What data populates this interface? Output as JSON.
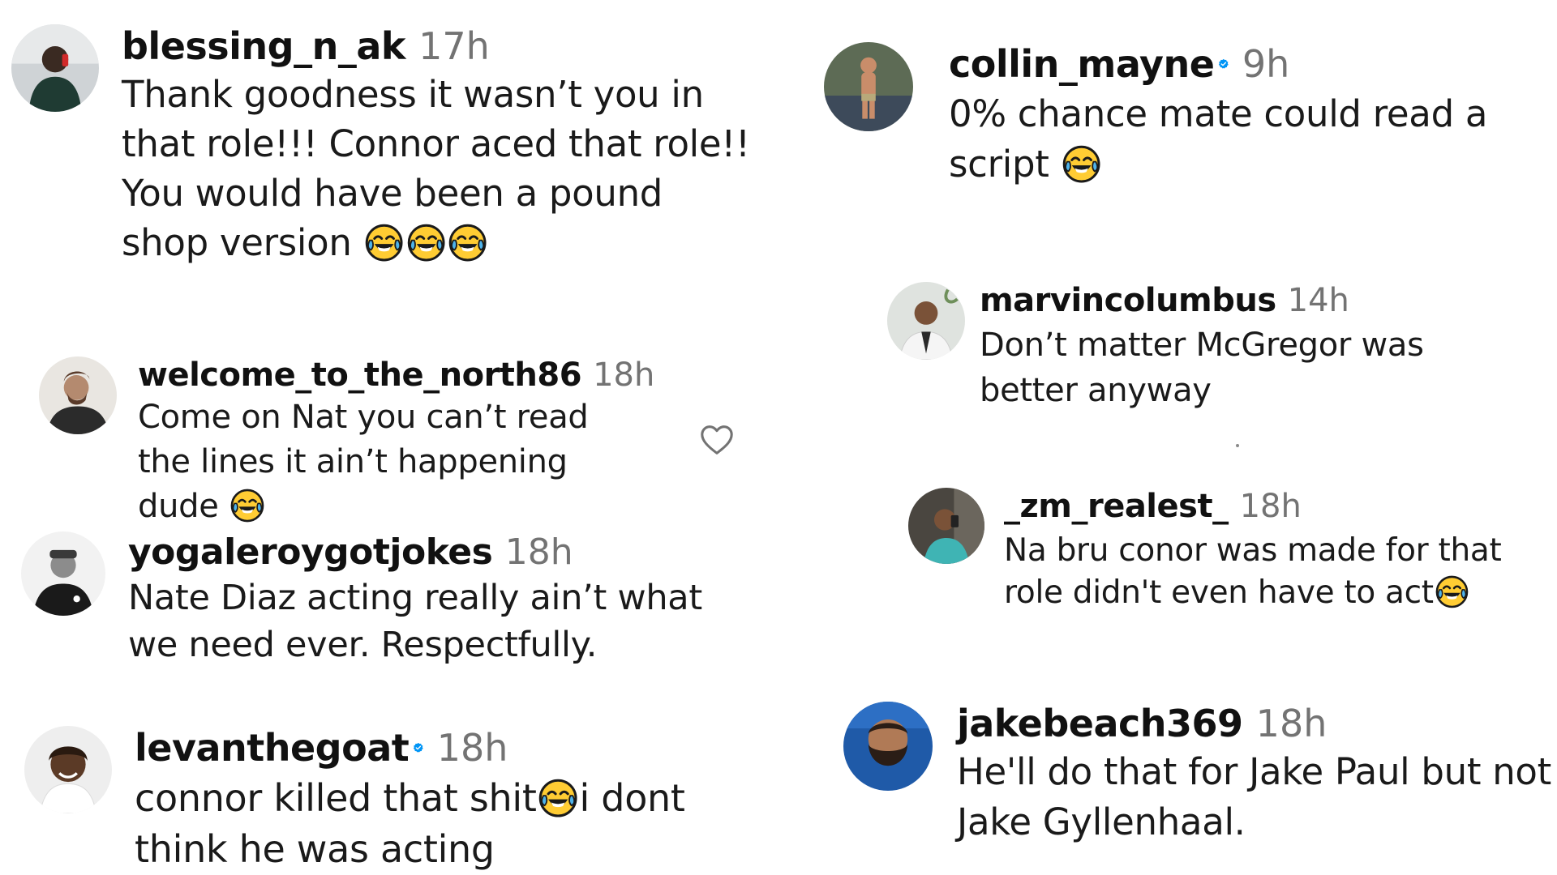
{
  "comments": [
    {
      "id": "blessing",
      "username": "blessing_n_ak",
      "time": "17h",
      "verified": false,
      "text_parts": [
        "Thank goodness it wasn’t you in that role!!! Connor aced that role!! You would have been a pound shop version "
      ],
      "emojis": "face-with-tears-of-joy x3"
    },
    {
      "id": "welcome",
      "username": "welcome_to_the_north86",
      "time": "18h",
      "verified": false,
      "text_parts": [
        "Come on Nat you can’t read the lines it ain’t happening dude "
      ],
      "emojis": "face-with-tears-of-joy x1",
      "like_icon": "heart-outline-icon"
    },
    {
      "id": "yoga",
      "username": "yogaleroygotjokes",
      "time": "18h",
      "verified": false,
      "text_parts": [
        "Nate Diaz acting really ain’t what we need ever. Respectfully."
      ]
    },
    {
      "id": "levan",
      "username": "levanthegoat",
      "time": "18h",
      "verified": true,
      "text_parts": [
        "connor killed that shit",
        "i dont think he was acting"
      ],
      "emojis": "face-with-tears-of-joy x1"
    },
    {
      "id": "collin",
      "username": "collin_mayne",
      "time": "9h",
      "verified": true,
      "text_parts": [
        "0% chance mate could read a script "
      ],
      "emojis": "face-with-tears-of-joy x1"
    },
    {
      "id": "marvin",
      "username": "marvincolumbus",
      "time": "14h",
      "verified": false,
      "text_parts": [
        "Don’t matter McGregor was better anyway"
      ]
    },
    {
      "id": "zm",
      "username": "_zm_realest_",
      "time": "18h",
      "verified": false,
      "text_parts": [
        "Na bru conor was made for that role didn't even have to act"
      ],
      "emojis": "face-with-tears-of-joy x1"
    },
    {
      "id": "jake",
      "username": "jakebeach369",
      "time": "18h",
      "verified": false,
      "text_parts": [
        "He'll do that for Jake Paul but not Jake Gyllenhaal."
      ]
    }
  ],
  "colors": {
    "username": "#111111",
    "timestamp": "#737373",
    "verified_badge": "#0095f6",
    "text": "#1a1a1a",
    "background": "#ffffff"
  }
}
